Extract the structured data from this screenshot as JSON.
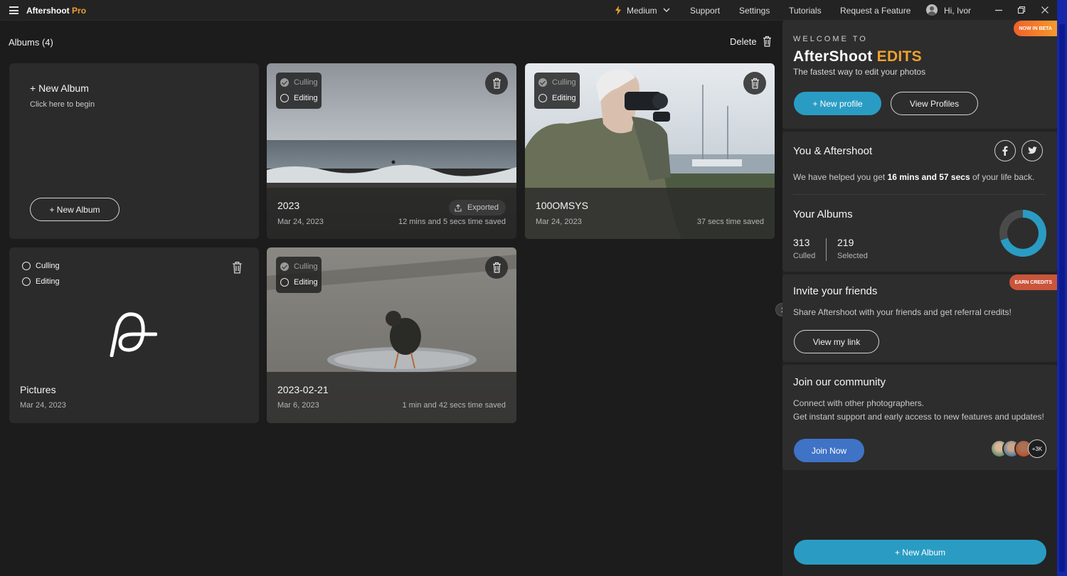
{
  "app": {
    "name": "Aftershoot",
    "edition": "Pro"
  },
  "topnav": {
    "performance": "Medium",
    "support": "Support",
    "settings": "Settings",
    "tutorials": "Tutorials",
    "request_feature": "Request a Feature",
    "greeting": "Hi, Ivor"
  },
  "main": {
    "albums_title": "Albums (4)",
    "delete_label": "Delete",
    "new_album_card": {
      "title": "+ New Album",
      "subtitle": "Click here to begin",
      "button": "+ New Album"
    },
    "toggles": {
      "culling": "Culling",
      "editing": "Editing"
    },
    "albums": [
      {
        "title": "2023",
        "date": "Mar 24, 2023",
        "saved": "12 mins and 5 secs time saved",
        "exported": "Exported",
        "culling_done": true
      },
      {
        "title": "100OMSYS",
        "date": "Mar 24, 2023",
        "saved": "37 secs time saved",
        "culling_done": true
      },
      {
        "title": "Pictures",
        "date": "Mar 24, 2023",
        "culling_done": false
      },
      {
        "title": "2023-02-21",
        "date": "Mar 6, 2023",
        "saved": "1 min and 42 secs time saved",
        "culling_done": true
      }
    ]
  },
  "sidebar": {
    "edits": {
      "badge": "NOW IN BETA",
      "welcome": "WELCOME TO",
      "logo_main": "AfterShoot",
      "logo_accent": "EDITS",
      "subtitle": "The fastest way to edit your photos",
      "new_profile": "+ New profile",
      "view_profiles": "View Profiles"
    },
    "you": {
      "title": "You & Aftershoot",
      "helped_prefix": "We have helped you get",
      "helped_time": "16 mins and 57 secs",
      "helped_suffix": "of your life back.",
      "albums_title": "Your Albums",
      "culled_value": "313",
      "culled_label": "Culled",
      "selected_value": "219",
      "selected_label": "Selected"
    },
    "invite": {
      "badge": "EARN CREDITS",
      "title": "Invite your friends",
      "text": "Share Aftershoot with your friends and get referral credits!",
      "button": "View my link"
    },
    "community": {
      "title": "Join our community",
      "line1": "Connect with other photographers.",
      "line2": "Get instant support and early access to new features and updates!",
      "button": "Join Now",
      "members_more": "+3K"
    },
    "new_album_button": "+ New Album"
  },
  "colors": {
    "accent_orange": "#f0a22c",
    "accent_blue": "#2a9cc3",
    "join_blue": "#3f73c6",
    "earn_badge": "#c9553b",
    "beta_badge": "#f0752c"
  },
  "icons": [
    "menu-icon",
    "lightning-icon",
    "chevron-down-icon",
    "user-icon",
    "minimize-icon",
    "restore-icon",
    "close-icon",
    "trash-icon",
    "export-icon",
    "facebook-icon",
    "twitter-icon",
    "chevron-right-icon",
    "aftershoot-logo-icon"
  ]
}
